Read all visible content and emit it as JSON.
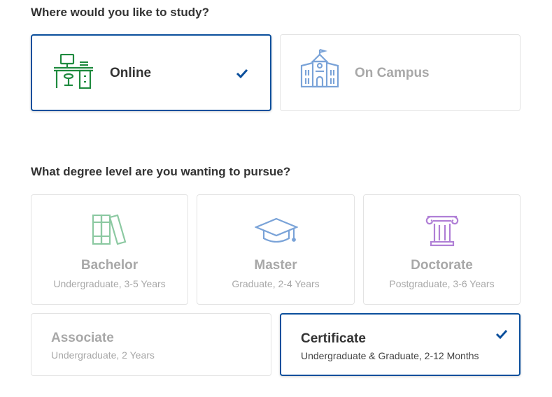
{
  "study": {
    "question": "Where would you like to study?",
    "options": [
      {
        "label": "Online",
        "selected": true
      },
      {
        "label": "On Campus",
        "selected": false
      }
    ]
  },
  "degree": {
    "question": "What degree level are you wanting to pursue?",
    "options": [
      {
        "title": "Bachelor",
        "subtitle": "Undergraduate, 3-5 Years",
        "selected": false
      },
      {
        "title": "Master",
        "subtitle": "Graduate, 2-4 Years",
        "selected": false
      },
      {
        "title": "Doctorate",
        "subtitle": "Postgraduate, 3-6 Years",
        "selected": false
      },
      {
        "title": "Associate",
        "subtitle": "Undergraduate, 2 Years",
        "selected": false
      },
      {
        "title": "Certificate",
        "subtitle": "Undergraduate & Graduate, 2-12 Months",
        "selected": true
      }
    ]
  },
  "icons": {
    "online": "desk-computer-icon",
    "campus": "campus-building-icon",
    "bachelor": "books-icon",
    "master": "graduation-cap-icon",
    "doctorate": "column-icon",
    "check": "checkmark-icon"
  },
  "colors": {
    "selected_border": "#0b4f9c",
    "check": "#0b4f9c",
    "online_icon": "#1e8a3e",
    "campus_icon": "#7aa3d8",
    "bachelor_icon": "#8cc9a2",
    "master_icon": "#7aa3d8",
    "doctorate_icon": "#b07fd6"
  }
}
